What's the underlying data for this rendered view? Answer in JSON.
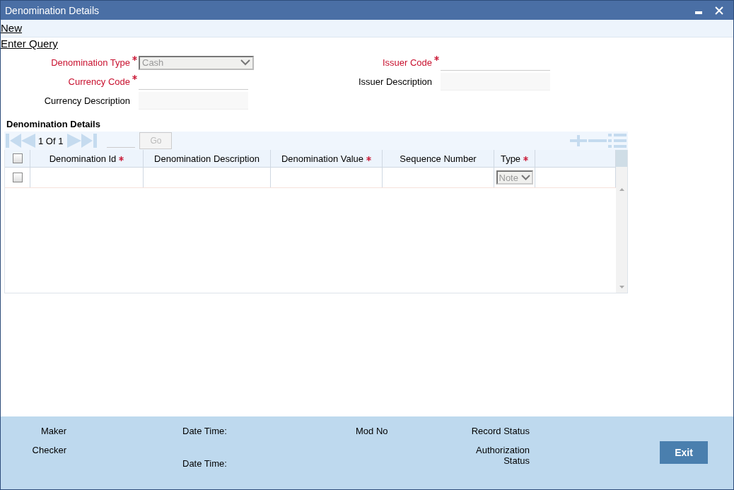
{
  "window": {
    "title": "Denomination Details"
  },
  "menu": [
    {
      "label": "New"
    },
    {
      "label": "Enter Query"
    }
  ],
  "form_left": [
    {
      "label": "Denomination Type",
      "required": true,
      "kind": "select",
      "value": "Cash"
    },
    {
      "label": "Currency Code",
      "required": true,
      "kind": "text"
    },
    {
      "label": "Currency Description",
      "required": false,
      "kind": "readonly"
    }
  ],
  "form_right": [
    {
      "label": "Issuer Code",
      "required": true,
      "kind": "text"
    },
    {
      "label": "Issuer Description",
      "required": false,
      "kind": "readonly"
    }
  ],
  "section_title": "Denomination Details",
  "pager": {
    "text": "1 Of 1",
    "go": "Go"
  },
  "table": {
    "select_all": {
      "checked": false
    },
    "columns": [
      {
        "label": "Denomination Id",
        "required": true
      },
      {
        "label": "Denomination Description",
        "required": false
      },
      {
        "label": "Denomination Value",
        "required": true
      },
      {
        "label": "Sequence Number",
        "required": false
      },
      {
        "label": "Type",
        "required": true
      }
    ],
    "rows": [
      {
        "checked": false,
        "type": "Note"
      }
    ]
  },
  "footer": {
    "maker": "Maker",
    "checker": "Checker",
    "date_time_1": "Date Time:",
    "date_time_2": "Date Time:",
    "mod_no": "Mod No",
    "record_status": "Record Status",
    "authorization_status": "Authorization Status"
  },
  "buttons": [
    {
      "label": "Exit"
    }
  ]
}
